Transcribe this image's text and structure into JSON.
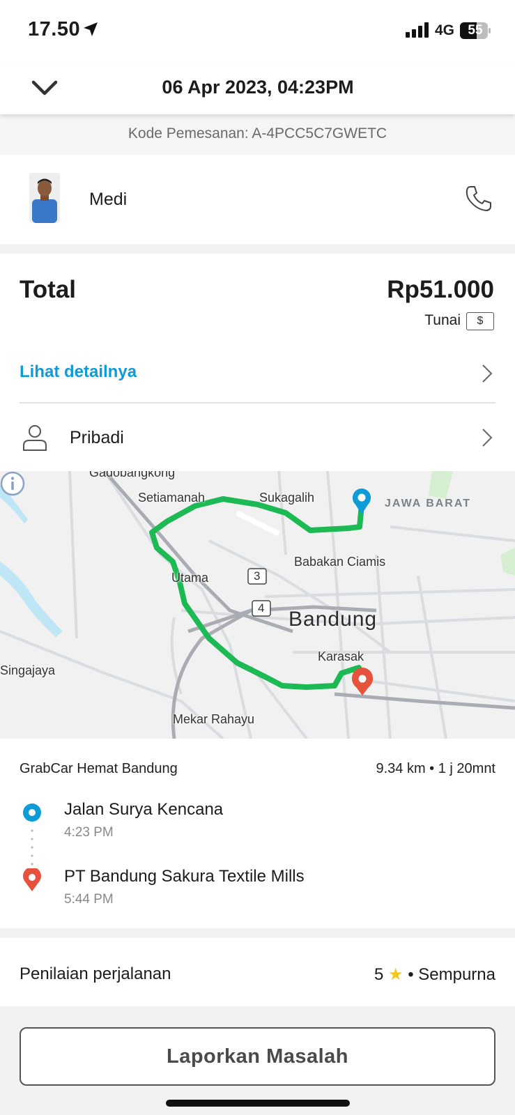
{
  "status_bar": {
    "time": "17.50",
    "network": "4G",
    "battery": "55"
  },
  "header": {
    "title": "06 Apr 2023, 04:23PM"
  },
  "booking_code": "Kode Pemesanan: A-4PCC5C7GWETC",
  "driver": {
    "name": "Medi"
  },
  "payment": {
    "total_label": "Total",
    "total_amount": "Rp51.000",
    "method": "Tunai",
    "cash_symbol": "$",
    "detail_link": "Lihat detailnya",
    "profile": "Pribadi"
  },
  "map": {
    "labels": {
      "gadobangkong": "Gadobangkong",
      "setiamanah": "Setiamanah",
      "sukagalih": "Sukagalih",
      "jawa_barat": "JAWA BARAT",
      "babakan_ciamis": "Babakan Ciamis",
      "utama": "Utama",
      "road_3": "3",
      "road_4": "4",
      "bandung": "Bandung",
      "singajaya": "Singajaya",
      "karasak": "Karasak",
      "mekar_rahayu": "Mekar Rahayu"
    },
    "route_color": "#1db954",
    "pickup_color": "#0f9bd7",
    "dropoff_color": "#e5533d"
  },
  "trip": {
    "service": "GrabCar Hemat Bandung",
    "stats": "9.34 km • 1 j 20mnt",
    "pickup": {
      "name": "Jalan Surya Kencana",
      "time": "4:23 PM"
    },
    "dropoff": {
      "name": "PT Bandung Sakura Textile Mills",
      "time": "5:44 PM"
    }
  },
  "rating": {
    "label": "Penilaian perjalanan",
    "score": "5",
    "star": "★",
    "separator": "•",
    "word": "Sempurna"
  },
  "report_button": "Laporkan Masalah"
}
